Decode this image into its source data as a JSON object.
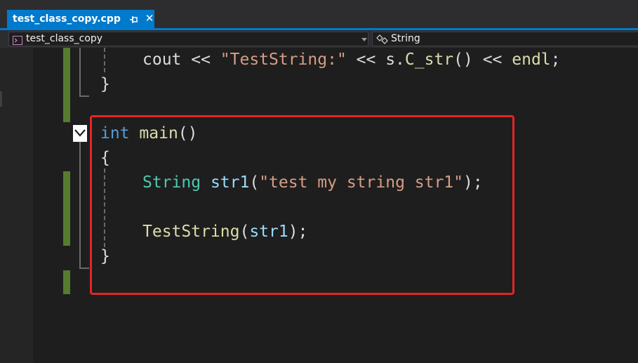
{
  "tab": {
    "title": "test_class_copy.cpp"
  },
  "navbar": {
    "scope": "test_class_copy",
    "member": "String"
  },
  "code": {
    "line1": {
      "cout": "cout",
      "op1": " << ",
      "lit": "\"TestString:\"",
      "op2": " << ",
      "obj": "s",
      "dot": ".",
      "method": "C_str",
      "args": "()",
      "op3": " << ",
      "endl": "endl",
      "semi": ";"
    },
    "line2": {
      "brace": "}"
    },
    "line3": {
      "kw": "int",
      "sp": " ",
      "fn": "main",
      "args": "()"
    },
    "line4": {
      "brace": "{"
    },
    "line5": {
      "type": "String",
      "sp": " ",
      "var": "str1",
      "open": "(",
      "lit": "\"test my string str1\"",
      "close": ");"
    },
    "line6": {
      "fn": "TestString",
      "open": "(",
      "arg": "str1",
      "close": ");"
    },
    "line7": {
      "brace": "}"
    }
  },
  "colors": {
    "accent": "#007acc",
    "highlight": "#e52424",
    "change_bar": "#577b2f"
  }
}
